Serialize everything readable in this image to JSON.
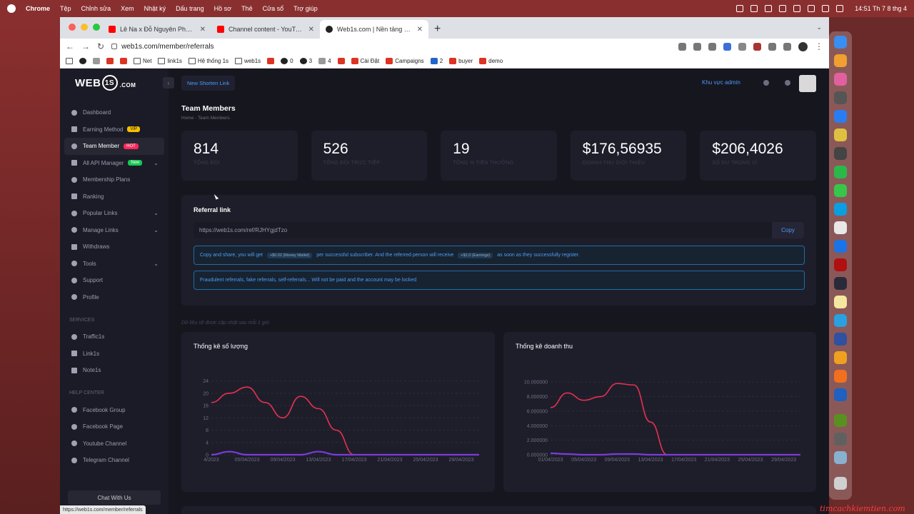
{
  "menubar": {
    "app": "Chrome",
    "items": [
      "Tệp",
      "Chỉnh sửa",
      "Xem",
      "Nhật ký",
      "Dấu trang",
      "Hồ sơ",
      "Thẻ",
      "Cửa sổ",
      "Trợ giúp"
    ],
    "clock": "14:51 Th 7 8 thg 4"
  },
  "tabs": [
    {
      "title": "Lê Na x Đỗ Nguyên Phúc Mash",
      "icon": "youtube-icon"
    },
    {
      "title": "Channel content - YouTube Stu",
      "icon": "youtube-icon"
    },
    {
      "title": "Web1s.com | Nền tảng kiếm tiề",
      "icon": "web1s-icon"
    }
  ],
  "address": {
    "url": "web1s.com/member/referrals"
  },
  "bookmarks": [
    "Net",
    "link1s",
    "Hệ thống 1s",
    "web1s",
    "0",
    "3",
    "4",
    "Cài Đặt",
    "Campaigns",
    "2",
    "buyer",
    "demo"
  ],
  "logo": {
    "part1": "WEB",
    "part2": "1S",
    "part3": ".COM"
  },
  "sidebar": {
    "items": [
      {
        "label": "Dashboard",
        "icon": "dashboard-icon"
      },
      {
        "label": "Earning Method",
        "icon": "magic-wand-icon",
        "tag": "VIP"
      },
      {
        "label": "Team Member",
        "icon": "users-icon",
        "tag": "HOT"
      },
      {
        "label": "All API Manager",
        "icon": "layers-icon",
        "tag": "New"
      },
      {
        "label": "Membership Plans",
        "icon": "star-icon"
      },
      {
        "label": "Ranking",
        "icon": "ranking-icon"
      },
      {
        "label": "Popular Links",
        "icon": "popular-icon"
      },
      {
        "label": "Manage Links",
        "icon": "link-icon"
      },
      {
        "label": "Withdraws",
        "icon": "wallet-icon"
      },
      {
        "label": "Tools",
        "icon": "tools-icon"
      },
      {
        "label": "Support",
        "icon": "support-icon"
      },
      {
        "label": "Profile",
        "icon": "profile-icon"
      }
    ],
    "services_label": "SERVICES",
    "services": [
      {
        "label": "Traffic1s",
        "icon": "rocket-icon"
      },
      {
        "label": "Link1s",
        "icon": "layers-icon"
      },
      {
        "label": "Note1s",
        "icon": "code-icon"
      }
    ],
    "help_label": "HELP CENTER",
    "help": [
      {
        "label": "Facebook Group",
        "icon": "facebook-icon"
      },
      {
        "label": "Facebook Page",
        "icon": "facebook-icon"
      },
      {
        "label": "Youtube Channel",
        "icon": "youtube-icon"
      },
      {
        "label": "Telegram Channel",
        "icon": "telegram-icon"
      }
    ],
    "chat_label": "Chat With Us"
  },
  "topbar": {
    "shorten_label": "New Shorten Link",
    "admin_label": "Khu vực admin"
  },
  "header": {
    "title": "Team Members",
    "breadcrumb_home": "Home",
    "breadcrumb_current": "Team Members"
  },
  "stats": [
    {
      "value": "814",
      "label": "TỔNG ĐỘI"
    },
    {
      "value": "526",
      "label": "TỔNG ĐỘI TRỰC TIẾP"
    },
    {
      "value": "19",
      "label": "TỔNG % TIỀN THƯỞNG"
    },
    {
      "value": "$176,56935",
      "label": "DOANH THU GIỚI THIỆU"
    },
    {
      "value": "$206,4026",
      "label": "SỐ DƯ TRONG VÍ"
    }
  ],
  "referral": {
    "title": "Referral link",
    "url": "https://web1s.com/ref/RJHYgjdTzo",
    "copy_label": "Copy",
    "alert1_a": "Copy and share, you will get",
    "alert1_pill1": "+$0.02 (Money Wallet)",
    "alert1_b": "per successful subscriber. And the referred person will receive",
    "alert1_pill2": "+$1.0 (Earnings)",
    "alert1_c": "as soon as they successfully register.",
    "alert2": "Fraudulent referrals, fake referrals, self-referrals... Will not be paid and the account may be locked"
  },
  "update_note": "Dữ liệu sẽ được cập nhật sau mỗi 1 giờ.",
  "status_url": "https://web1s.com/member/referrals",
  "watermark": "timcachkiemtien.com",
  "colors": {
    "accent": "#4d9cf5",
    "series_red": "#e8304f",
    "series_purple": "#7b3bdb",
    "bg": "#16161f",
    "card": "#1e1e2b"
  },
  "chart_data": [
    {
      "type": "line",
      "title": "Thống kê số lượng",
      "x": [
        "01/04/2023",
        "03/04/2023",
        "05/04/2023",
        "07/04/2023",
        "09/04/2023",
        "11/04/2023",
        "13/04/2023",
        "15/04/2023",
        "17/04/2023",
        "19/04/2023",
        "21/04/2023",
        "23/04/2023",
        "25/04/2023",
        "27/04/2023",
        "29/04/2023",
        "30/04/2023"
      ],
      "x_tick_labels": [
        "4/2023",
        "05/04/2023",
        "09/04/2023",
        "13/04/2023",
        "17/04/2023",
        "21/04/2023",
        "25/04/2023",
        "29/04/2023"
      ],
      "y_ticks": [
        0,
        4,
        8,
        12,
        16,
        20,
        24
      ],
      "ylim": [
        0,
        26
      ],
      "series": [
        {
          "values": [
            17,
            20,
            22,
            17,
            12,
            19,
            15,
            8,
            0,
            0,
            0,
            0,
            0,
            0,
            0,
            0
          ]
        },
        {
          "values": [
            0,
            1,
            0,
            0,
            0,
            0,
            1,
            0,
            0,
            0,
            0,
            0,
            0,
            0,
            0,
            0
          ]
        }
      ]
    },
    {
      "type": "line",
      "title": "Thống kê doanh thu",
      "x": [
        "01/04/2023",
        "03/04/2023",
        "05/04/2023",
        "07/04/2023",
        "09/04/2023",
        "11/04/2023",
        "13/04/2023",
        "15/04/2023",
        "17/04/2023",
        "19/04/2023",
        "21/04/2023",
        "23/04/2023",
        "25/04/2023",
        "27/04/2023",
        "29/04/2023",
        "30/04/2023"
      ],
      "x_tick_labels": [
        "01/04/2023",
        "05/04/2023",
        "09/04/2023",
        "13/04/2023",
        "17/04/2023",
        "21/04/2023",
        "25/04/2023",
        "29/04/2023"
      ],
      "y_ticks": [
        0,
        2,
        4,
        6,
        8,
        10
      ],
      "y_tick_labels": [
        "0.000000",
        "2.000000",
        "4.000000",
        "6.000000",
        "8.000000",
        "10.000000"
      ],
      "ylim": [
        0,
        11
      ],
      "series": [
        {
          "values": [
            6.5,
            8.5,
            7.5,
            8,
            9.8,
            9.6,
            4.5,
            0,
            0,
            0,
            0,
            0,
            0,
            0,
            0,
            0
          ]
        },
        {
          "values": [
            0.2,
            0.1,
            0,
            0,
            0.1,
            0.1,
            0,
            0,
            0,
            0,
            0,
            0,
            0,
            0,
            0,
            0
          ]
        }
      ]
    }
  ]
}
